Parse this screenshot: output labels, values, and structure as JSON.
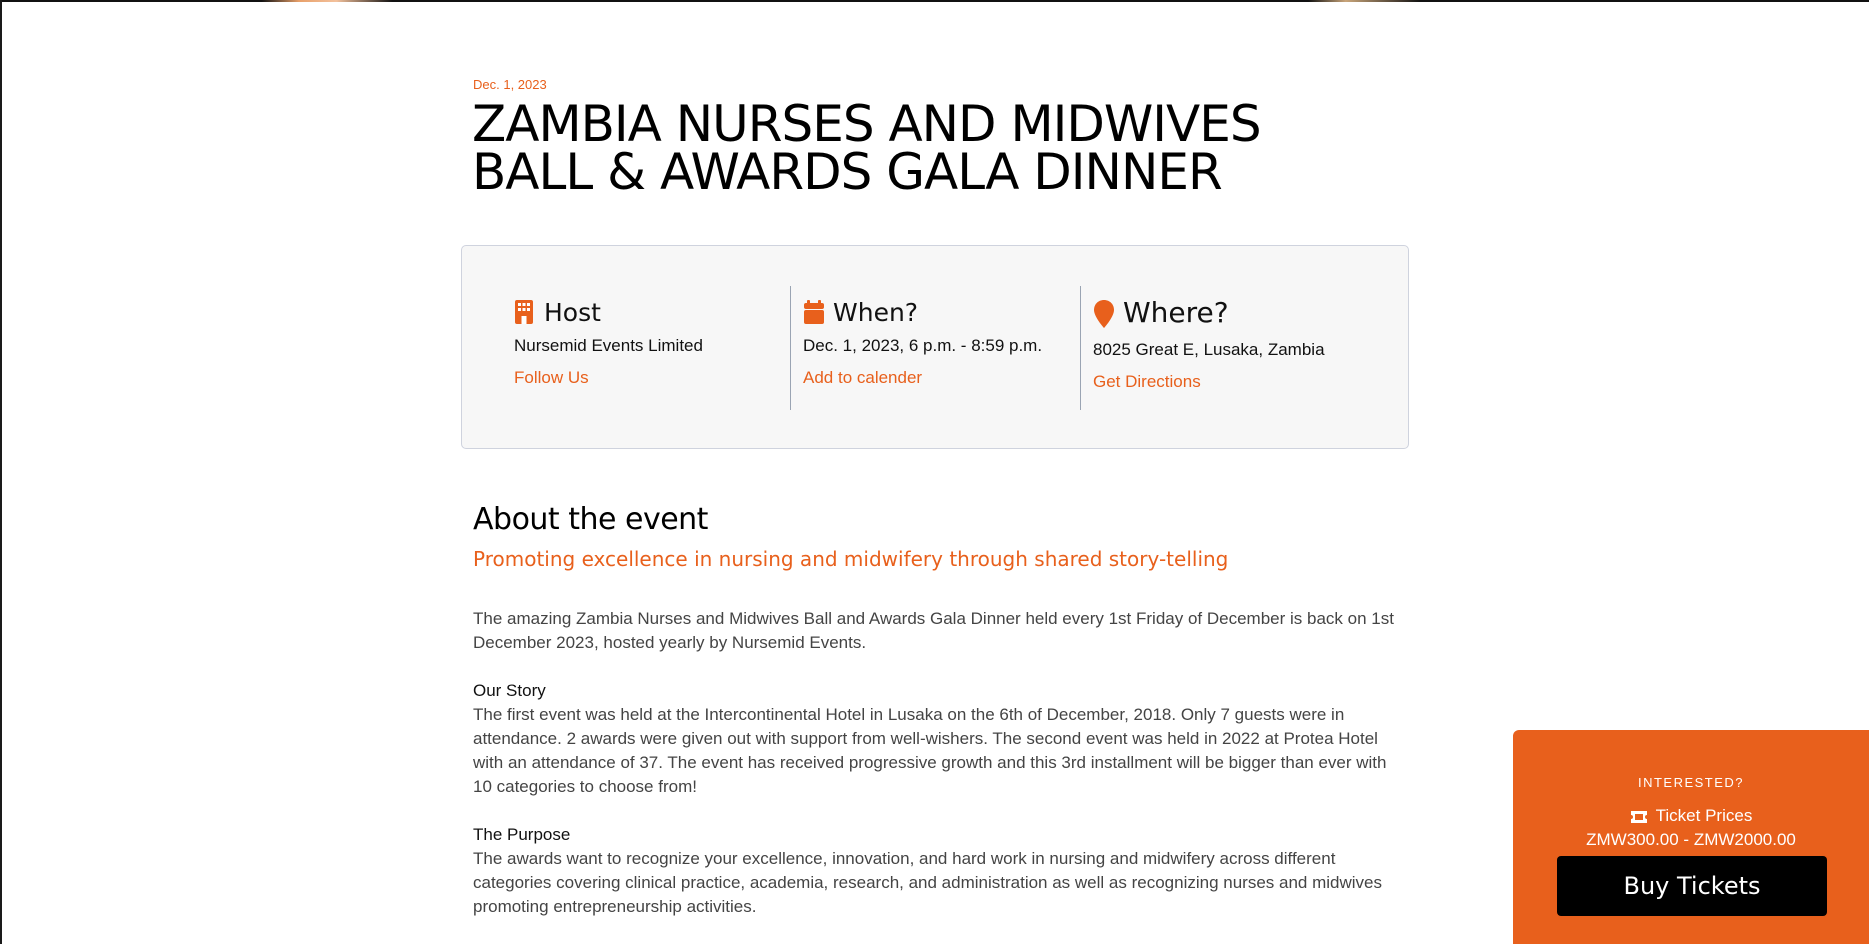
{
  "event": {
    "date": "Dec. 1, 2023",
    "title_line1": "ZAMBIA NURSES AND MIDWIVES",
    "title_line2": "BALL & AWARDS GALA DINNER"
  },
  "info": {
    "host": {
      "label": "Host",
      "icon": "building-icon",
      "value": "Nursemid Events Limited",
      "link": "Follow Us"
    },
    "when": {
      "label": "When?",
      "icon": "calendar-icon",
      "value": "Dec. 1, 2023, 6 p.m. - 8:59 p.m.",
      "link": "Add to calender"
    },
    "where": {
      "label": "Where?",
      "icon": "map-pin-icon",
      "value": "8025 Great E, Lusaka, Zambia",
      "link": "Get Directions"
    }
  },
  "about": {
    "heading": "About the event",
    "subheading": "Promoting excellence in nursing and midwifery through shared story-telling",
    "intro": "The amazing Zambia Nurses and Midwives Ball and Awards Gala Dinner held every 1st Friday of December is back on 1st December 2023, hosted yearly by Nursemid Events.",
    "story_heading": "Our Story",
    "story": "The first event was held at the Intercontinental Hotel in Lusaka on the 6th of December, 2018. Only 7 guests were in attendance. 2 awards were given out with support from well-wishers. The second event was held in 2022 at Protea Hotel with an attendance of 37. The event has received progressive growth and this 3rd installment will be bigger than ever with 10 categories to choose from!",
    "purpose_heading": "The Purpose",
    "purpose": "The awards want to recognize your excellence, innovation, and hard work in nursing and midwifery across different categories covering clinical practice, academia, research, and administration as well as recognizing nurses and midwives promoting entrepreneurship activities."
  },
  "ticket": {
    "interested": "INTERESTED?",
    "prices_label": "Ticket Prices",
    "prices_icon": "ticket-icon",
    "prices": "ZMW300.00 - ZMW2000.00",
    "buy_label": "Buy Tickets"
  },
  "colors": {
    "accent": "#e8601c",
    "button": "#000000",
    "panel": "#f7f7f7"
  }
}
